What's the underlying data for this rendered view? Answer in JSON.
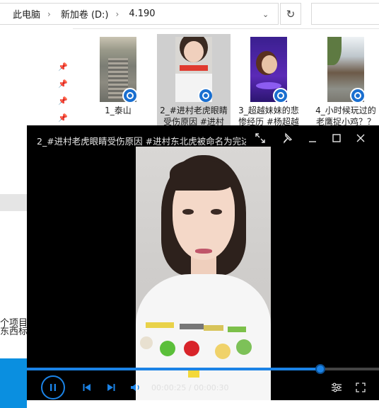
{
  "explorer": {
    "breadcrumb": [
      "此电脑",
      "新加卷 (D:)",
      "4.190"
    ],
    "files": [
      {
        "name": "1_泰山",
        "icon": "video-file-icon"
      },
      {
        "name": "2_#进村老虎眼睛受伤原因 #进村",
        "icon": "video-file-icon"
      },
      {
        "name": "3_超越妹妹的悲惨经历 #杨超越",
        "icon": "video-file-icon"
      },
      {
        "name": "4_小时候玩过的老鹰捉小鸡？？",
        "icon": "video-file-icon"
      }
    ],
    "nav": {
      "line1": "个项目",
      "line2": "东西标注"
    }
  },
  "player": {
    "title": "2_#进村老虎眼睛受伤原因 #进村东北虎被命名为完达...",
    "progress": 0.833,
    "time_current": "00:00:25",
    "time_separator": " / ",
    "time_total": "00:00:30",
    "accent": "#1b83e6"
  }
}
